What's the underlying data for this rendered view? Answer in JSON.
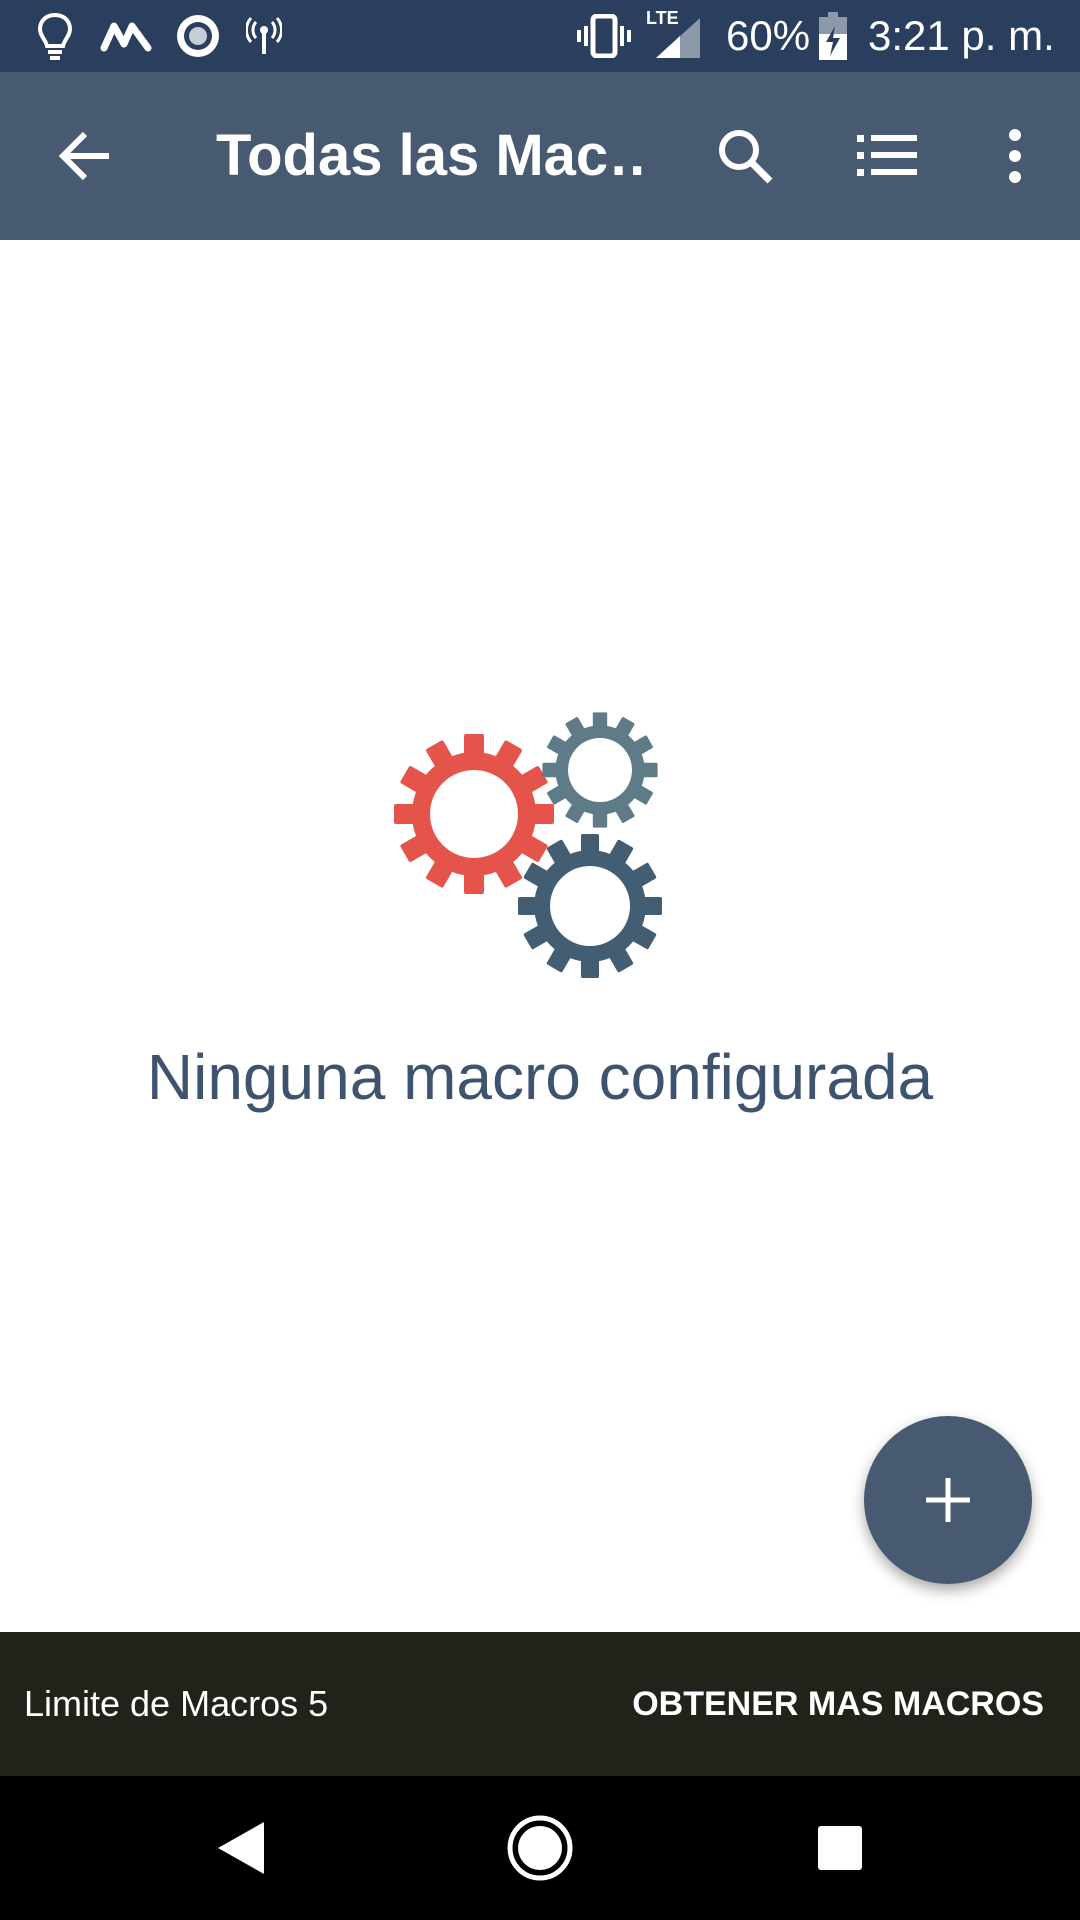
{
  "status_bar": {
    "icons": [
      "lightbulb-icon",
      "m-logo-icon",
      "record-icon",
      "broadcast-icon",
      "vibrate-icon",
      "lte-signal-icon",
      "battery-charging-icon"
    ],
    "lte_label": "LTE",
    "battery": "60%",
    "time": "3:21 p. m."
  },
  "app_bar": {
    "title": "Todas las Mac…",
    "icons": [
      "back-arrow-icon",
      "search-icon",
      "list-icon",
      "more-vert-icon"
    ],
    "background": "#485a71"
  },
  "empty_state": {
    "icon": "gears-icon",
    "message": "Ninguna macro configurada",
    "colors": {
      "gear_red": "#e4544a",
      "gear_gray": "#5f7b88",
      "gear_dark": "#435d72"
    }
  },
  "fab": {
    "icon": "plus-icon"
  },
  "snackbar": {
    "message": "Limite de Macros 5",
    "action": "OBTENER MAS MACROS"
  },
  "nav_bar": {
    "icons": [
      "nav-back-icon",
      "nav-home-icon",
      "nav-recents-icon"
    ]
  }
}
